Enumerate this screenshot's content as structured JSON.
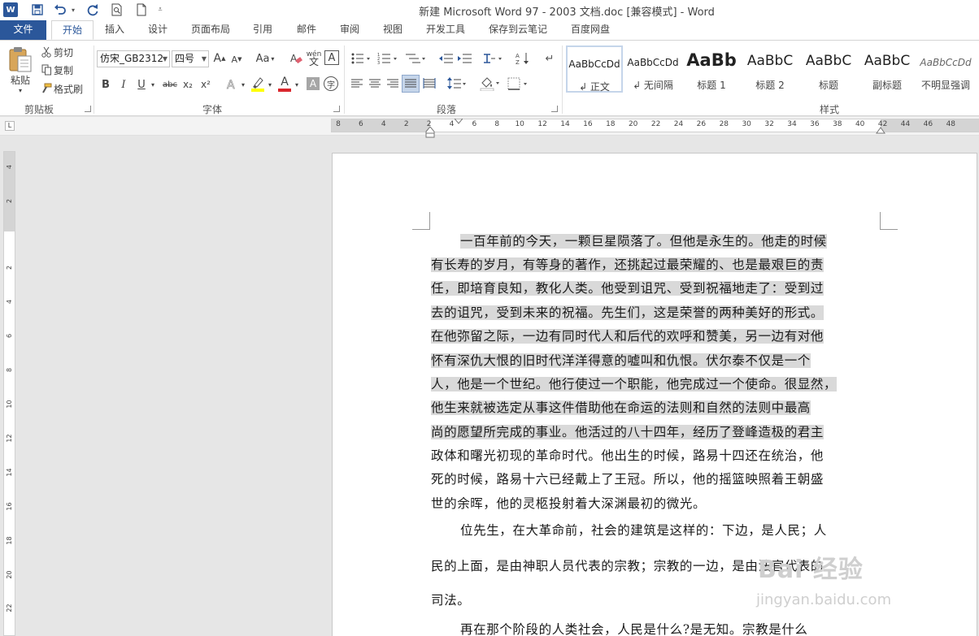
{
  "window": {
    "title": "新建 Microsoft Word 97 - 2003 文档.doc [兼容模式] - Word",
    "app_icon": "word-logo-icon",
    "quick_access": [
      "save-icon",
      "undo-icon",
      "undo-dropdown-icon",
      "redo-icon",
      "print-preview-icon",
      "new-document-icon",
      "customize-quick-access-icon"
    ]
  },
  "tabs": [
    "文件",
    "开始",
    "插入",
    "设计",
    "页面布局",
    "引用",
    "邮件",
    "审阅",
    "视图",
    "开发工具",
    "保存到云笔记",
    "百度网盘"
  ],
  "active_tab": "开始",
  "ribbon": {
    "clipboard": {
      "paste": "粘贴",
      "cut": "剪切",
      "copy": "复制",
      "format_painter": "格式刷",
      "group_label": "剪贴板"
    },
    "font": {
      "font_name": "仿宋_GB2312",
      "font_size": "四号",
      "change_case": "Aa",
      "grow_font": "A",
      "shrink_font": "A",
      "phonetic": "wén",
      "bold": "B",
      "italic": "I",
      "underline": "U",
      "strikethrough": "abc",
      "subscript": "x₂",
      "superscript": "x²",
      "font_color_letter": "A",
      "group_label": "字体"
    },
    "paragraph": {
      "group_label": "段落"
    },
    "styles": {
      "items": [
        {
          "sample": "AaBbCcDd",
          "name": "↲ 正文"
        },
        {
          "sample": "AaBbCcDd",
          "name": "↲ 无间隔"
        },
        {
          "sample": "AaBb",
          "name": "标题 1"
        },
        {
          "sample": "AaBbC",
          "name": "标题 2"
        },
        {
          "sample": "AaBbC",
          "name": "标题"
        },
        {
          "sample": "AaBbC",
          "name": "副标题"
        },
        {
          "sample": "AaBbCcDd",
          "name": "不明显强调"
        }
      ],
      "selected_index": 0,
      "group_label": "样式"
    }
  },
  "rulers": {
    "horizontal_ticks": [
      "8",
      "6",
      "4",
      "2",
      "2",
      "4",
      "6",
      "8",
      "10",
      "12",
      "14",
      "16",
      "18",
      "20",
      "22",
      "24",
      "26",
      "28",
      "30",
      "32",
      "34",
      "36",
      "38",
      "40",
      "42",
      "44",
      "46",
      "48"
    ],
    "vertical_ticks": [
      "4",
      "2",
      "2",
      "4",
      "6",
      "8",
      "10",
      "12",
      "14",
      "16",
      "18",
      "20",
      "22"
    ],
    "tab_selector": "L"
  },
  "document": {
    "lines": [
      "一百年前的今天，一颗巨星陨落了。但他是永生的。他走的时候",
      "有长寿的岁月，有等身的著作，还挑起过最荣耀的、也是最艰巨的责",
      "任，即培育良知，教化人类。他受到诅咒、受到祝福地走了：受到过",
      "去的诅咒，受到未来的祝福。先生们，这是荣誉的两种美好的形式。",
      "在他弥留之际，一边有同时代人和后代的欢呼和赞美，另一边有对他",
      "怀有深仇大恨的旧时代洋洋得意的嘘叫和仇恨。伏尔泰不仅是一个",
      "人，他是一个世纪。他行使过一个职能，他完成过一个使命。很显然，",
      "他生来就被选定从事这件借助他在命运的法则和自然的法则中最高",
      "尚的愿望所完成的事业。他活过的八十四年，经历了登峰造极的君主",
      "政体和曙光初现的革命时代。他出生的时候，路易十四还在统治，他",
      "死的时候，路易十六已经戴上了王冠。所以，他的摇篮映照着王朝盛",
      "世的余晖，他的灵柩投射着大深渊最初的微光。",
      "位先生，在大革命前，社会的建筑是这样的：下边，是人民；人",
      "民的上面，是由神职人员代表的宗教；宗教的一边，是由法官代表的",
      "司法。",
      "再在那个阶段的人类社会，人民是什么?是无知。宗教是什么"
    ],
    "selection": {
      "lines": [
        0,
        1,
        2,
        3,
        4,
        5,
        6,
        7,
        8
      ],
      "note_visible": false
    }
  },
  "watermark": {
    "main": "Bai 经验",
    "sub": "jingyan.baidu.com"
  },
  "colors": {
    "accent": "#2b579a",
    "selection": "#d9d9d9",
    "font_color_bar": "#d9262c",
    "highlight_bar": "#ffff00"
  }
}
